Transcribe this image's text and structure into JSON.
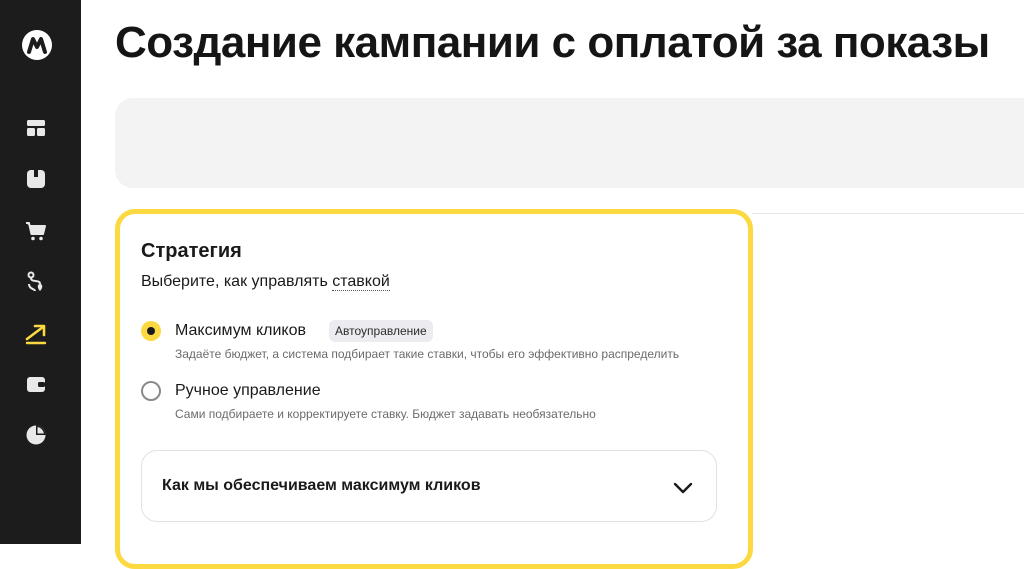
{
  "sidebar": {
    "logo_icon": "market-logo-icon",
    "items": [
      {
        "icon": "dashboard-icon",
        "active": false
      },
      {
        "icon": "box-icon",
        "active": false
      },
      {
        "icon": "cart-icon",
        "active": false
      },
      {
        "icon": "route-icon",
        "active": false
      },
      {
        "icon": "trend-arrow-icon",
        "active": true
      },
      {
        "icon": "wallet-icon",
        "active": false
      },
      {
        "icon": "pie-chart-icon",
        "active": false
      }
    ],
    "active_color": "#fcd940"
  },
  "page": {
    "title": "Создание кампании с оплатой за показы"
  },
  "strategy": {
    "heading": "Стратегия",
    "subtitle_prefix": "Выберите, как управлять ",
    "subtitle_link": "ставкой",
    "options": [
      {
        "label": "Максимум кликов",
        "badge": "Автоуправление",
        "description": "Задаёте бюджет, а система подбирает такие ставки, чтобы его эффективно распределить",
        "selected": true
      },
      {
        "label": "Ручное управление",
        "description": "Сами подбираете и корректируете ставку. Бюджет задавать необязательно",
        "selected": false
      }
    ],
    "accordion": {
      "title": "Как мы обеспечиваем максимум кликов",
      "icon": "chevron-down-icon"
    }
  },
  "colors": {
    "accent": "#fcd940",
    "sidebar_bg": "#1c1c1c"
  }
}
